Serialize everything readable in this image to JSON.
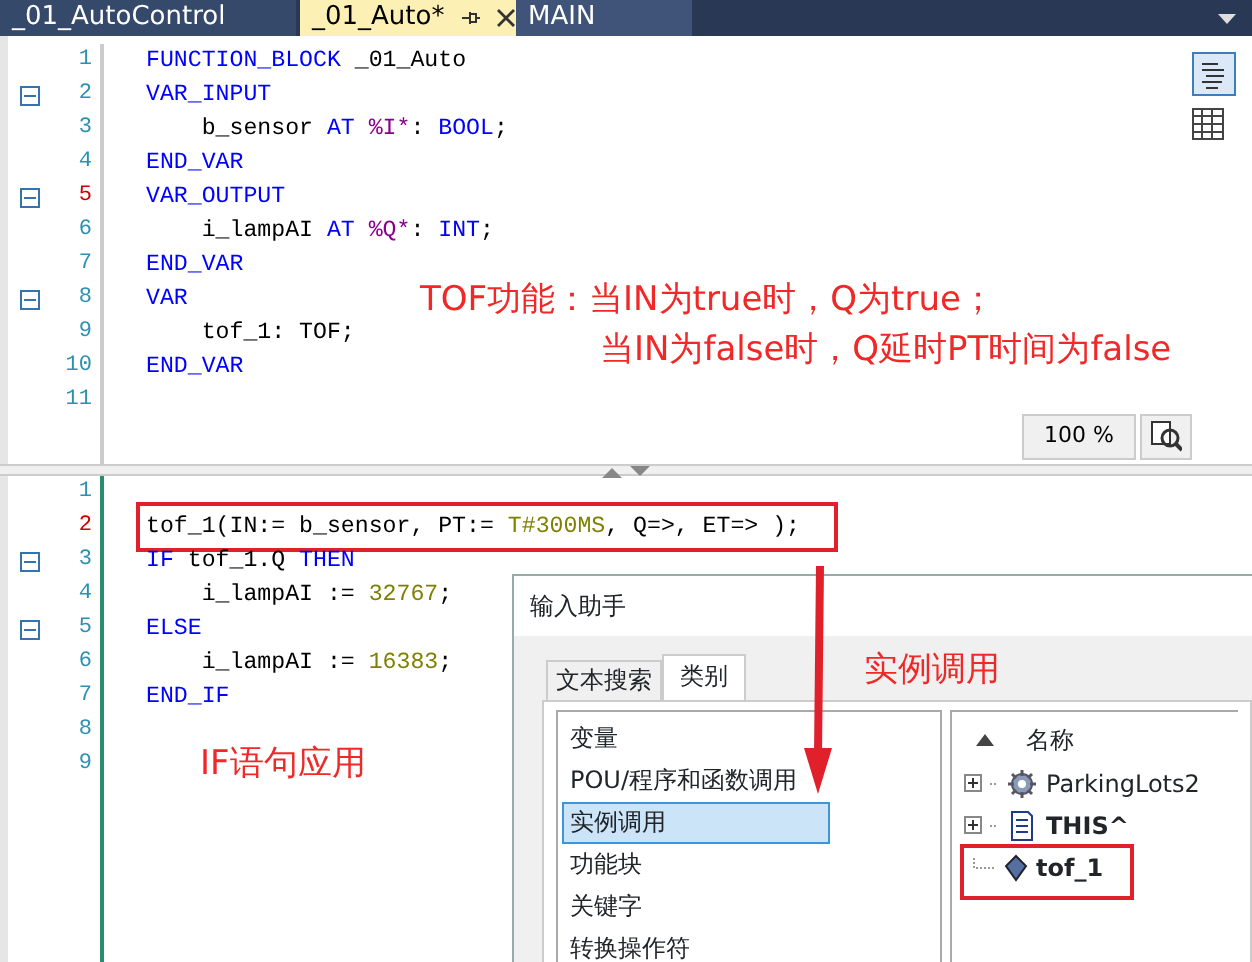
{
  "tabs": [
    {
      "label": "_01_AutoControl",
      "selected": false,
      "pinnable": false
    },
    {
      "label": "_01_Auto*",
      "selected": true,
      "pinnable": true
    },
    {
      "label": "MAIN",
      "selected": false,
      "pinnable": false
    }
  ],
  "declaration_editor": {
    "zoom": "100 %",
    "lines": [
      {
        "number": "1",
        "changed": false,
        "fold": false,
        "tokens": [
          {
            "kind": "kw",
            "text": "FUNCTION_BLOCK"
          },
          {
            "kind": "plain",
            "text": " _01_Auto"
          }
        ]
      },
      {
        "number": "2",
        "changed": false,
        "fold": true,
        "tokens": [
          {
            "kind": "kw",
            "text": "VAR_INPUT"
          }
        ]
      },
      {
        "number": "3",
        "changed": false,
        "fold": false,
        "tokens": [
          {
            "kind": "plain",
            "text": "    b_sensor "
          },
          {
            "kind": "kw",
            "text": "AT"
          },
          {
            "kind": "addr",
            "text": " %I*"
          },
          {
            "kind": "plain",
            "text": ": "
          },
          {
            "kind": "kw",
            "text": "BOOL"
          },
          {
            "kind": "plain",
            "text": ";"
          }
        ]
      },
      {
        "number": "4",
        "changed": false,
        "fold": false,
        "tokens": [
          {
            "kind": "kw",
            "text": "END_VAR"
          }
        ]
      },
      {
        "number": "5",
        "changed": true,
        "fold": true,
        "tokens": [
          {
            "kind": "kw",
            "text": "VAR_OUTPUT"
          }
        ]
      },
      {
        "number": "6",
        "changed": false,
        "fold": false,
        "tokens": [
          {
            "kind": "plain",
            "text": "    i_lampAI "
          },
          {
            "kind": "kw",
            "text": "AT"
          },
          {
            "kind": "addr",
            "text": " %Q*"
          },
          {
            "kind": "plain",
            "text": ": "
          },
          {
            "kind": "kw",
            "text": "INT"
          },
          {
            "kind": "plain",
            "text": ";"
          }
        ]
      },
      {
        "number": "7",
        "changed": false,
        "fold": false,
        "tokens": [
          {
            "kind": "kw",
            "text": "END_VAR"
          }
        ]
      },
      {
        "number": "8",
        "changed": false,
        "fold": true,
        "tokens": [
          {
            "kind": "kw",
            "text": "VAR"
          }
        ]
      },
      {
        "number": "9",
        "changed": false,
        "fold": false,
        "tokens": [
          {
            "kind": "plain",
            "text": "    tof_1: TOF;"
          }
        ]
      },
      {
        "number": "10",
        "changed": false,
        "fold": false,
        "tokens": [
          {
            "kind": "kw",
            "text": "END_VAR"
          }
        ]
      },
      {
        "number": "11",
        "changed": false,
        "fold": false
      }
    ]
  },
  "implementation_editor": {
    "lines": [
      {
        "number": "1",
        "changed": false,
        "fold": false
      },
      {
        "number": "2",
        "changed": true,
        "fold": false,
        "framed": true,
        "tokens": [
          {
            "kind": "plain",
            "text": "tof_1(IN:= b_sensor, PT:= "
          },
          {
            "kind": "lit",
            "text": "T#300MS"
          },
          {
            "kind": "plain",
            "text": ", Q=>, ET=> );"
          }
        ]
      },
      {
        "number": "3",
        "changed": false,
        "fold": true,
        "tokens": [
          {
            "kind": "kw",
            "text": "IF"
          },
          {
            "kind": "plain",
            "text": " tof_1.Q "
          },
          {
            "kind": "kw",
            "text": "THEN"
          }
        ]
      },
      {
        "number": "4",
        "changed": false,
        "fold": false,
        "tokens": [
          {
            "kind": "plain",
            "text": "    i_lampAI := "
          },
          {
            "kind": "lit",
            "text": "32767"
          },
          {
            "kind": "plain",
            "text": ";"
          }
        ]
      },
      {
        "number": "5",
        "changed": false,
        "fold": true,
        "tokens": [
          {
            "kind": "kw",
            "text": "ELSE"
          }
        ]
      },
      {
        "number": "6",
        "changed": false,
        "fold": false,
        "tokens": [
          {
            "kind": "plain",
            "text": "    i_lampAI := "
          },
          {
            "kind": "lit",
            "text": "16383"
          },
          {
            "kind": "plain",
            "text": ";"
          }
        ]
      },
      {
        "number": "7",
        "changed": false,
        "fold": false,
        "tokens": [
          {
            "kind": "kw",
            "text": "END_IF"
          }
        ]
      },
      {
        "number": "8",
        "changed": false,
        "fold": false
      },
      {
        "number": "9",
        "changed": false,
        "fold": false
      }
    ]
  },
  "input_assistant": {
    "title": "输入助手",
    "tabs": [
      {
        "label": "文本搜索",
        "selected": false
      },
      {
        "label": "类别",
        "selected": true
      }
    ],
    "categories": [
      {
        "label": "变量",
        "selected": false
      },
      {
        "label": "POU/程序和函数调用",
        "selected": false
      },
      {
        "label": "实例调用",
        "selected": true
      },
      {
        "label": "功能块",
        "selected": false
      },
      {
        "label": "关键字",
        "selected": false
      },
      {
        "label": "转换操作符",
        "selected": false
      }
    ],
    "tree_header": "名称",
    "tree_items": [
      {
        "label": "ParkingLots2",
        "kind": "program",
        "expanded": false,
        "bold": false
      },
      {
        "label": "THIS^",
        "kind": "object",
        "expanded": false,
        "bold": true
      },
      {
        "label": "tof_1",
        "kind": "instance",
        "bold": true
      }
    ]
  },
  "annotations": [
    {
      "kind": "note",
      "text": "TOF功能：当IN为true时，Q为true；"
    },
    {
      "kind": "note2",
      "text": "当IN为false时，Q延时PT时间为false"
    },
    {
      "kind": "if",
      "text": "IF语句应用"
    },
    {
      "kind": "instance",
      "text": "实例调用"
    }
  ]
}
